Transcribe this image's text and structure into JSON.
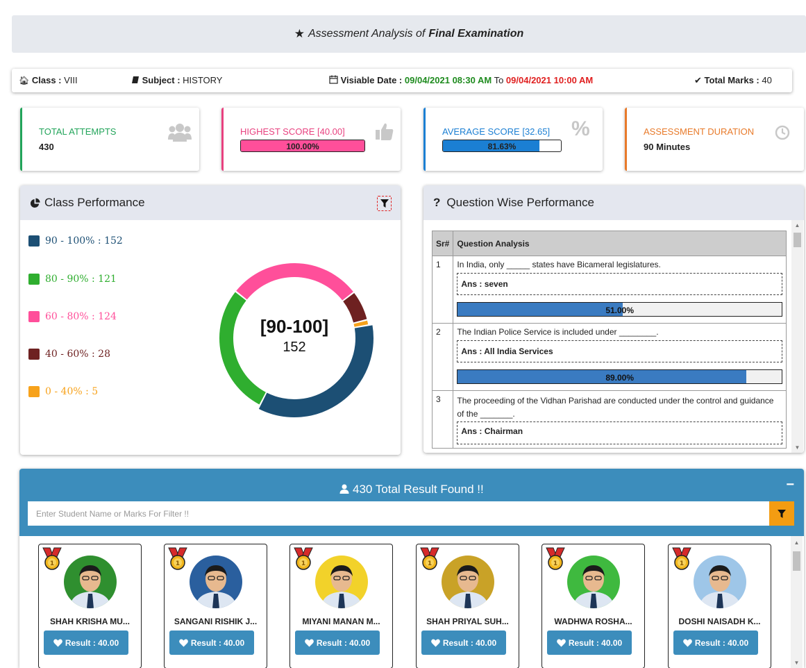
{
  "header": {
    "title_prefix": "Assessment Analysis of",
    "title_exam": "Final Examination"
  },
  "info": {
    "class_label": "Class :",
    "class_value": "VIII",
    "subject_label": "Subject :",
    "subject_value": "HISTORY",
    "date_label": "Visiable Date :",
    "date_from": "09/04/2021 08:30 AM",
    "date_to_word": "To",
    "date_to": "09/04/2021 10:00 AM",
    "marks_label": "Total Marks :",
    "marks_value": "40"
  },
  "stats": {
    "attempts_title": "TOTAL ATTEMPTS",
    "attempts_value": "430",
    "highest_title": "HIGHEST SCORE [40.00]",
    "highest_pct": "100.00%",
    "highest_fraction": 1.0,
    "average_title": "AVERAGE SCORE [32.65]",
    "average_pct": "81.63%",
    "average_fraction": 0.8163,
    "duration_title": "ASSESSMENT DURATION",
    "duration_value": "90 Minutes"
  },
  "colors": {
    "attempts": "#22a45a",
    "highest": "#e8417f",
    "average": "#1b7fd3",
    "duration": "#e87a2a",
    "s90": "#1c4f74",
    "s80": "#2fae2f",
    "s60": "#ff4f9a",
    "s40": "#6e2121",
    "s0": "#f7a21b"
  },
  "class_performance": {
    "title": "Class Performance",
    "center_label": "[90-100]",
    "center_value": "152",
    "legend": [
      {
        "label": "90 - 100% : 152"
      },
      {
        "label": "80 - 90% : 121"
      },
      {
        "label": "60 - 80% : 124"
      },
      {
        "label": "40 - 60% : 28"
      },
      {
        "label": "0 - 40% : 5"
      }
    ]
  },
  "chart_data": {
    "type": "pie",
    "labels": [
      "90 - 100%",
      "80 - 90%",
      "60 - 80%",
      "40 - 60%",
      "0 - 40%"
    ],
    "values": [
      152,
      121,
      124,
      28,
      5
    ],
    "colors": [
      "#1c4f74",
      "#2fae2f",
      "#ff4f9a",
      "#6e2121",
      "#f7a21b"
    ],
    "highlighted": "90 - 100%"
  },
  "question_performance": {
    "title": "Question Wise Performance",
    "col_sr": "Sr#",
    "col_analysis": "Question Analysis",
    "questions": [
      {
        "sr": "1",
        "text": "In India, only _____ states have Bicameral legislatures.",
        "answer": "Ans : seven",
        "pct": "51.00%",
        "fraction": 0.51
      },
      {
        "sr": "2",
        "text": "The Indian Police Service is included under ________.",
        "answer": "Ans : All India Services",
        "pct": "89.00%",
        "fraction": 0.89
      },
      {
        "sr": "3",
        "text": "The proceeding of the Vidhan Parishad are conducted under the control and guidance of the _______.",
        "answer": "Ans : Chairman"
      }
    ]
  },
  "results": {
    "title": "430 Total Result Found !!",
    "filter_placeholder": "Enter Student Name or Marks For Filter !!",
    "students": [
      {
        "name": "SHAH KRISHA MU...",
        "result": "Result : 40.00",
        "bg": "#2f8f2f"
      },
      {
        "name": "SANGANI RISHIK J...",
        "result": "Result : 40.00",
        "bg": "#2a5f9e"
      },
      {
        "name": "MIYANI MANAN M...",
        "result": "Result : 40.00",
        "bg": "#f2d22a"
      },
      {
        "name": "SHAH PRIYAL SUH...",
        "result": "Result : 40.00",
        "bg": "#c9a227"
      },
      {
        "name": "WADHWA ROSHA...",
        "result": "Result : 40.00",
        "bg": "#3fb93f"
      },
      {
        "name": "DOSHI NAISADH K...",
        "result": "Result : 40.00",
        "bg": "#9ec6e8"
      }
    ]
  }
}
